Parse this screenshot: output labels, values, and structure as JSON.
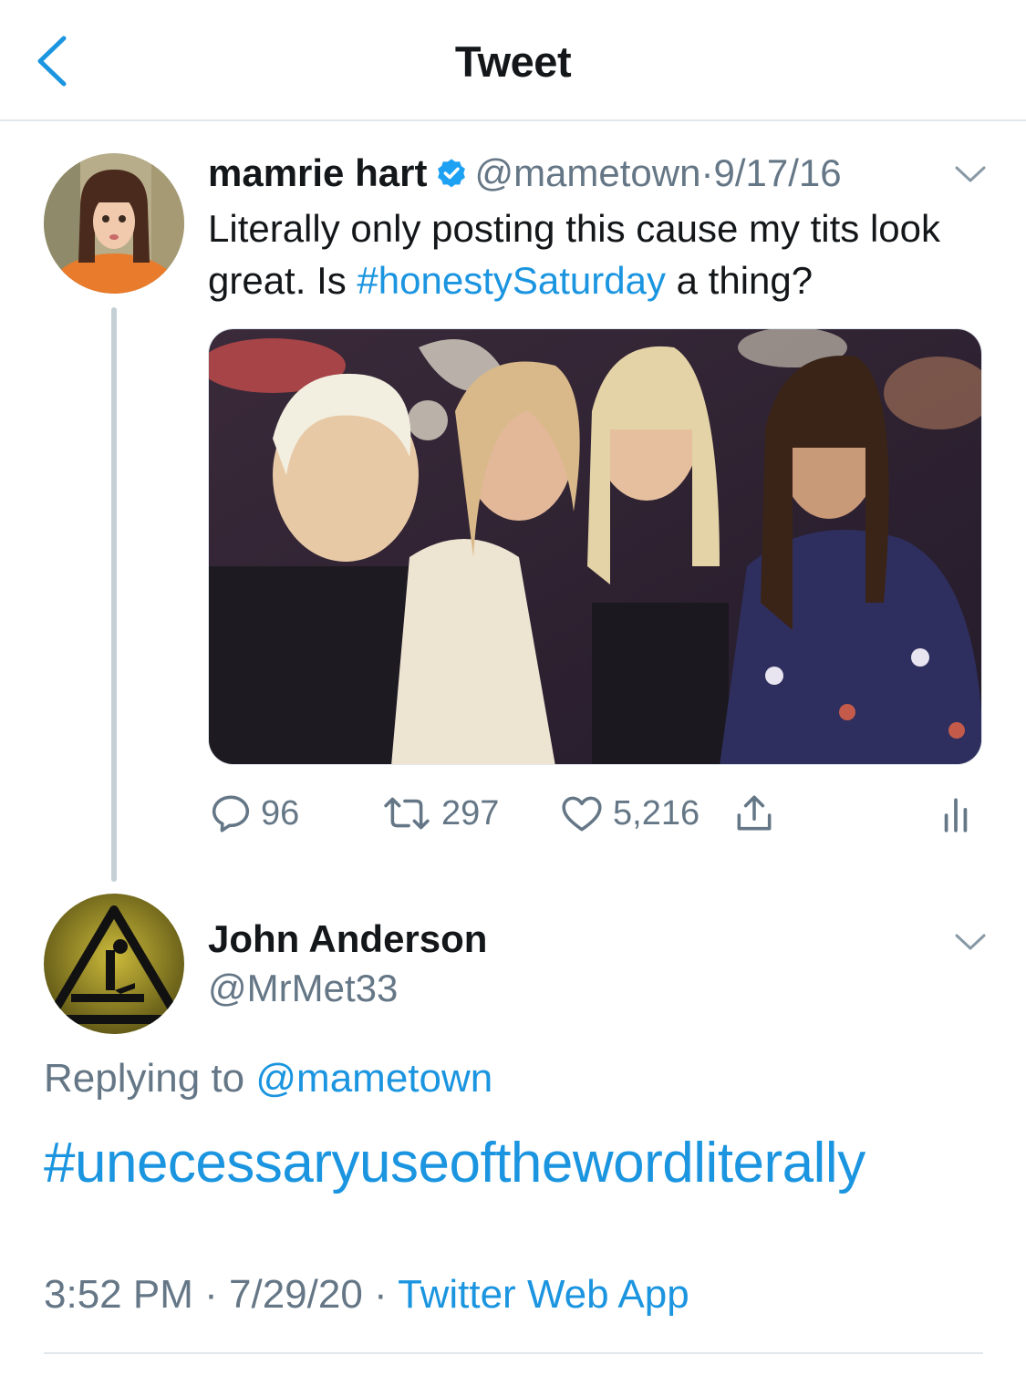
{
  "header": {
    "title": "Tweet"
  },
  "tweet": {
    "author_name": "mamrie hart",
    "handle": "@mametown",
    "separator": "·",
    "date": "9/17/16",
    "text_before": "Literally only posting this cause my tits look great. Is ",
    "hashtag": "#honestySaturday",
    "text_after": " a thing?",
    "photo_description": "photo",
    "stats": {
      "replies": "96",
      "retweets": "297",
      "likes": "5,216"
    }
  },
  "reply": {
    "author_name": "John Anderson",
    "handle": "@MrMet33",
    "replying_label": "Replying to",
    "replying_handle": "@mametown",
    "text": "#unecessaryuseofthewordliterally",
    "time": "3:52 PM",
    "separator": "·",
    "date": "7/29/20",
    "source": "Twitter Web App"
  },
  "colors": {
    "link": "#1b95e0",
    "muted": "#657786",
    "text": "#14171a",
    "divider": "#e1e8ed"
  }
}
